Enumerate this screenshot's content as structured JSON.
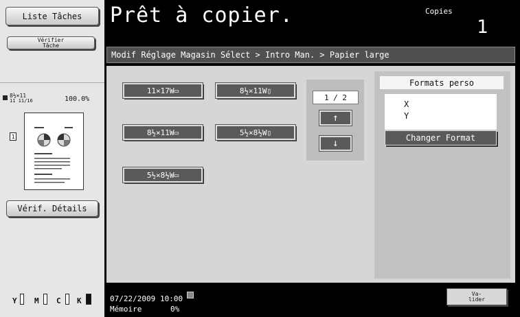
{
  "sidebar": {
    "jobs_button": "Liste Tâches",
    "verify_job_button": "Vérifier\nTâche",
    "preview": {
      "orientation_icon": "page-orientation-icon",
      "size_label": "8½×11",
      "size_sub": "11 11/16",
      "zoom": "100.0%"
    },
    "details_button": "Vérif. Détails",
    "toner": [
      "Y",
      "M",
      "C",
      "K"
    ]
  },
  "header": {
    "title": "Prêt à copier.",
    "copies_label": "Copies",
    "copies_value": "1"
  },
  "breadcrumb": "Modif Réglage Magasin Sélect > Intro Man. > Papier large",
  "paper_sizes": [
    "11×17W▭",
    "8½×11W▯",
    "8½×11W▭",
    "5½×8½W▯",
    "5½×8½W▭"
  ],
  "pager": {
    "indicator": "1 / 2",
    "up_icon": "arrow-up-icon",
    "down_icon": "arrow-down-icon"
  },
  "custom_formats": {
    "title": "Formats perso",
    "x_label": "X",
    "y_label": "Y",
    "change_button": "Changer Format"
  },
  "footer": {
    "date": "07/22/2009",
    "time": "10:00",
    "memory_label": "Mémoire",
    "memory_value": "0%",
    "network_icon": "network-icon",
    "validate_button": "Va-\nlider"
  }
}
